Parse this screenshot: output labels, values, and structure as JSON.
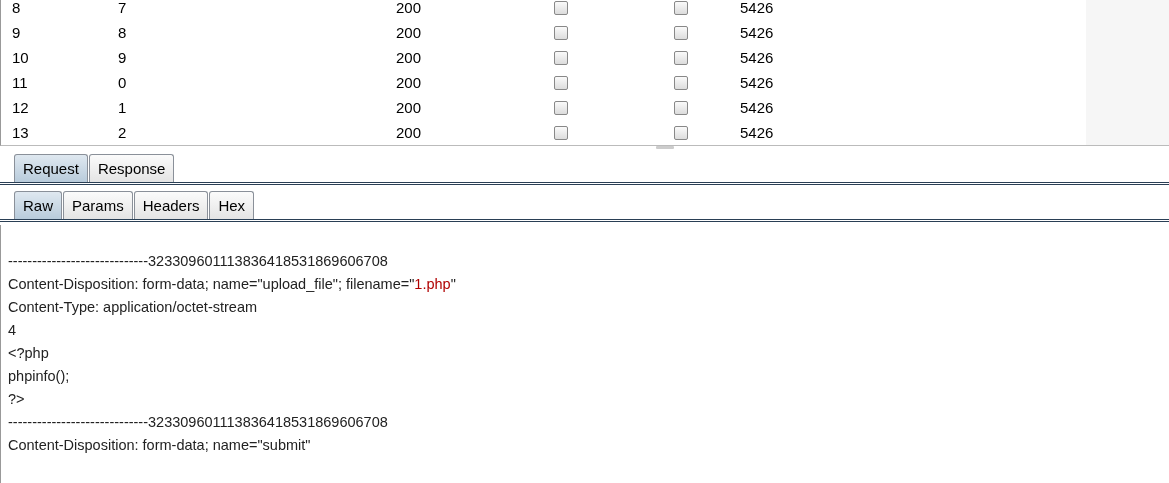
{
  "table": {
    "rows": [
      {
        "cells": [
          "8",
          "7",
          "200"
        ],
        "error": false,
        "timeout": false,
        "length": "5426"
      },
      {
        "cells": [
          "9",
          "8",
          "200"
        ],
        "error": false,
        "timeout": false,
        "length": "5426"
      },
      {
        "cells": [
          "10",
          "9",
          "200"
        ],
        "error": false,
        "timeout": false,
        "length": "5426"
      },
      {
        "cells": [
          "11",
          "0",
          "200"
        ],
        "error": false,
        "timeout": false,
        "length": "5426"
      },
      {
        "cells": [
          "12",
          "1",
          "200"
        ],
        "error": false,
        "timeout": false,
        "length": "5426"
      },
      {
        "cells": [
          "13",
          "2",
          "200"
        ],
        "error": false,
        "timeout": false,
        "length": "5426"
      }
    ]
  },
  "tabs": [
    {
      "label": "Request",
      "selected": true
    },
    {
      "label": "Response",
      "selected": false
    }
  ],
  "subtabs": [
    {
      "label": "Raw",
      "selected": true
    },
    {
      "label": "Params",
      "selected": false
    },
    {
      "label": "Headers",
      "selected": false
    },
    {
      "label": "Hex",
      "selected": false
    }
  ],
  "body": [
    [
      {
        "kind": "plain",
        "text": "-----------------------------323309601113836418531869606708"
      }
    ],
    [
      {
        "kind": "plain",
        "text": "Content-Disposition: form-data; name=\"upload_file\"; filename=\""
      },
      {
        "kind": "value",
        "text": "1.php"
      },
      {
        "kind": "plain",
        "text": "\""
      }
    ],
    [
      {
        "kind": "plain",
        "text": "Content-Type: application/octet-stream"
      }
    ],
    [
      {
        "kind": "plain",
        "text": "4"
      }
    ],
    [
      {
        "kind": "plain",
        "text": "<?php"
      }
    ],
    [
      {
        "kind": "plain",
        "text": "phpinfo();"
      }
    ],
    [
      {
        "kind": "plain",
        "text": "?>"
      }
    ],
    [
      {
        "kind": "plain",
        "text": "-----------------------------323309601113836418531869606708"
      }
    ],
    [
      {
        "kind": "plain",
        "text": "Content-Disposition: form-data; name=\"submit\""
      }
    ]
  ]
}
